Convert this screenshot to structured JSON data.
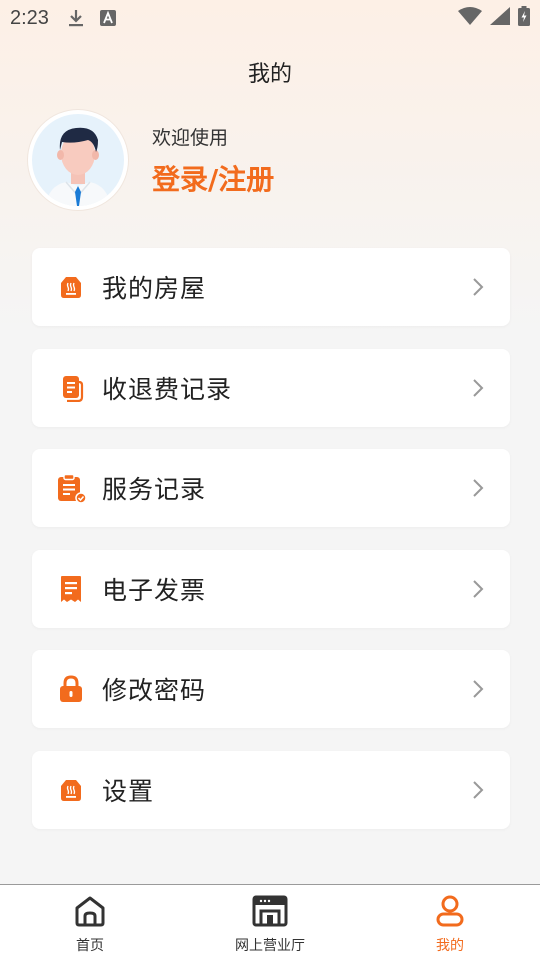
{
  "status_bar": {
    "time": "2:23"
  },
  "header": {
    "title": "我的"
  },
  "profile": {
    "welcome": "欢迎使用",
    "login_link": "登录/注册"
  },
  "menu": {
    "items": [
      {
        "label": "我的房屋",
        "icon": "house-icon"
      },
      {
        "label": "收退费记录",
        "icon": "receipt-icon"
      },
      {
        "label": "服务记录",
        "icon": "clipboard-check-icon"
      },
      {
        "label": "电子发票",
        "icon": "invoice-icon"
      },
      {
        "label": "修改密码",
        "icon": "lock-icon"
      },
      {
        "label": "设置",
        "icon": "settings-icon"
      }
    ]
  },
  "tabbar": {
    "tabs": [
      {
        "label": "首页",
        "icon": "home-icon",
        "active": false
      },
      {
        "label": "网上营业厅",
        "icon": "storefront-icon",
        "active": false
      },
      {
        "label": "我的",
        "icon": "user-icon",
        "active": true
      }
    ]
  },
  "colors": {
    "accent": "#f26b1d",
    "background": "#f5f5f5",
    "card": "#ffffff"
  }
}
